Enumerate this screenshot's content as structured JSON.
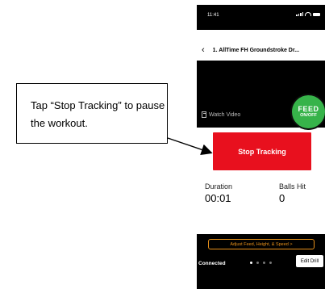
{
  "status_bar": {
    "time": "11:41"
  },
  "header": {
    "back_icon": "‹",
    "title": "1. AllTime FH Groundstroke Dr..."
  },
  "video": {
    "watch_label": "Watch Video"
  },
  "feed_button": {
    "line1": "FEED",
    "line2": "ON/OFF",
    "color": "#37b34a"
  },
  "stop_button": {
    "label": "Stop Tracking",
    "color": "#e8101e"
  },
  "stats": {
    "duration_label": "Duration",
    "duration_value": "00:01",
    "balls_label": "Balls Hit",
    "balls_value": "0"
  },
  "bottom_bar": {
    "adjust_label": "Adjust Feed, Height, & Speed >",
    "connection_status": "Connected",
    "edit_drill_label": "Edit Drill",
    "accent_color": "#e8911a"
  },
  "callout": {
    "text": "Tap “Stop Tracking” to pause the workout."
  }
}
